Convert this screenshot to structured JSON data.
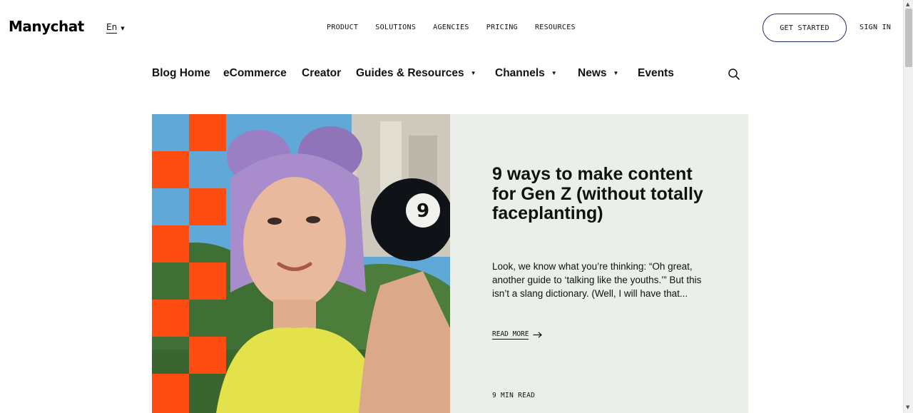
{
  "header": {
    "logo_text": "Manychat",
    "language_label": "En",
    "nav": [
      "PRODUCT",
      "SOLUTIONS",
      "AGENCIES",
      "PRICING",
      "RESOURCES"
    ],
    "get_started_label": "GET STARTED",
    "sign_in_label": "SIGN IN"
  },
  "blog_nav": {
    "items": [
      {
        "label": "Blog Home",
        "dropdown": false
      },
      {
        "label": "eCommerce",
        "dropdown": false
      },
      {
        "label": "Creator",
        "dropdown": false
      },
      {
        "label": "Guides & Resources",
        "dropdown": true
      },
      {
        "label": "Channels",
        "dropdown": true
      },
      {
        "label": "News",
        "dropdown": true
      },
      {
        "label": "Events",
        "dropdown": false
      }
    ],
    "search_icon": "search-icon"
  },
  "featured_post": {
    "title": "9 ways to make content for Gen Z (without totally faceplanting)",
    "excerpt": "Look, we know what you’re thinking: “Oh great, another guide to ‘talking like the youths.’” But this isn’t a slang dictionary. (Well, I will have that...",
    "read_more_label": "READ MORE",
    "read_time": "9 MIN READ",
    "ball_number": "9"
  },
  "colors": {
    "accent_orange": "#fd4d12",
    "panel_bg": "#ebefea",
    "button_border": "#1f2a6b"
  }
}
